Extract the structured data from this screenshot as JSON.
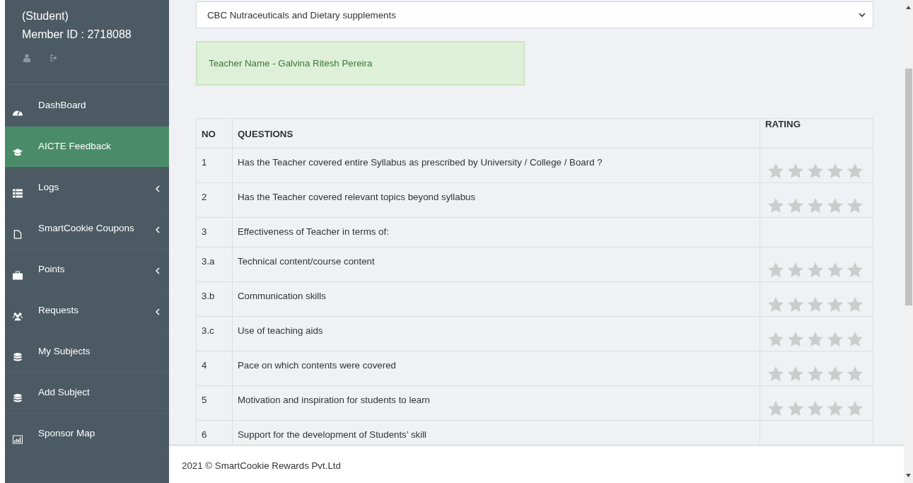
{
  "profile": {
    "role": "(Student)",
    "member_id": "Member ID : 2718088"
  },
  "sidebar": {
    "items": [
      {
        "label": "DashBoard",
        "kind": "dashboard",
        "selected": false,
        "submenu": false
      },
      {
        "label": "AICTE Feedback",
        "kind": "cap",
        "selected": true,
        "submenu": false
      },
      {
        "label": "Logs",
        "kind": "list",
        "selected": false,
        "submenu": true
      },
      {
        "label": "SmartCookie Coupons",
        "kind": "file",
        "selected": false,
        "submenu": true
      },
      {
        "label": "Points",
        "kind": "briefcase",
        "selected": false,
        "submenu": true
      },
      {
        "label": "Requests",
        "kind": "users",
        "selected": false,
        "submenu": true
      },
      {
        "label": "My Subjects",
        "kind": "database",
        "selected": false,
        "submenu": false
      },
      {
        "label": "Add Subject",
        "kind": "database",
        "selected": false,
        "submenu": false
      },
      {
        "label": "Sponsor Map",
        "kind": "chart",
        "selected": false,
        "submenu": false
      }
    ]
  },
  "subject_select": {
    "value": "CBC Nutraceuticals and Dietary supplements"
  },
  "teacher_alert": "Teacher Name - Galvina Ritesh Pereira",
  "table": {
    "columns": [
      "NO",
      "QUESTIONS",
      "RATING"
    ],
    "rows": [
      {
        "no": "1",
        "question": "Has the Teacher covered entire Syllabus as prescribed by University / College / Board ?",
        "stars": 0
      },
      {
        "no": "2",
        "question": "Has the Teacher covered relevant topics beyond syllabus",
        "stars": 0
      },
      {
        "no": "3",
        "question": "Effectiveness of Teacher in terms of:"
      },
      {
        "no": "3.a",
        "question": "Technical content/course content",
        "stars": 0
      },
      {
        "no": "3.b",
        "question": "Communication skills",
        "stars": 0
      },
      {
        "no": "3.c",
        "question": "Use of teaching aids",
        "stars": 0
      },
      {
        "no": "4",
        "question": "Pace on which contents were covered",
        "stars": 0
      },
      {
        "no": "5",
        "question": "Motivation and inspiration for students to learn",
        "stars": 0
      },
      {
        "no": "6",
        "question": "Support for the development of Students’ skill"
      }
    ]
  },
  "footer": "2021 © SmartCookie Rewards Pvt.Ltd"
}
